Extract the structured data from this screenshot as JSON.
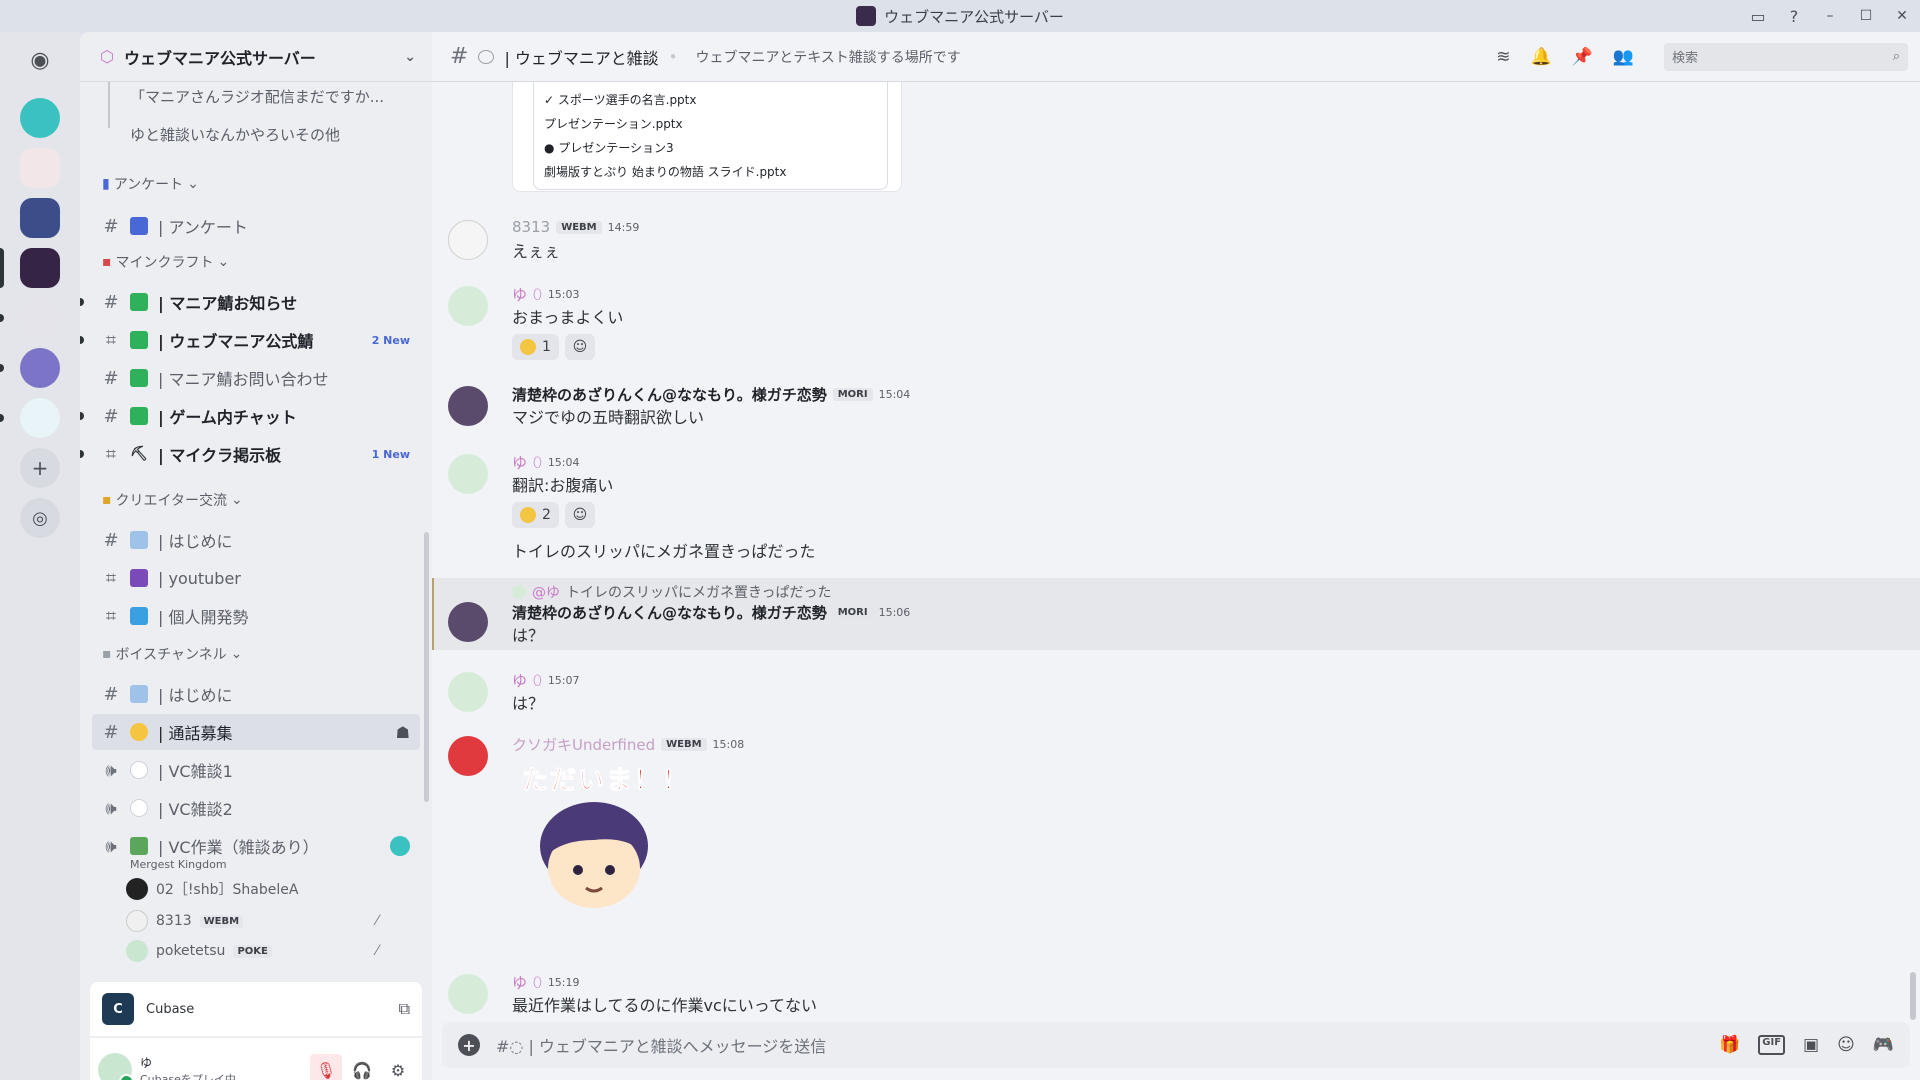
{
  "window": {
    "title": "ウェブマニア公式サーバー",
    "buttons": {
      "minimize": "–",
      "maximize": "☐",
      "close": "✕"
    }
  },
  "rail": {
    "servers": [
      "discord-home",
      "server-1",
      "server-2",
      "server-3",
      "server-4-active",
      "server-5",
      "server-6",
      "server-7",
      "add-server",
      "discover"
    ]
  },
  "sidebar": {
    "server_name": "ウェブマニア公式サーバー",
    "threads": [
      "「マニアさんラジオ配信まだですか...",
      "ゆと雑談いなんかやろいその他"
    ],
    "categories": {
      "survey": "アンケート",
      "minecraft": "マインクラフト",
      "creator": "クリエイター交流",
      "voice": "ボイスチャンネル"
    },
    "channels": {
      "survey": "| アンケート",
      "mania_news": "| マニア鯖お知らせ",
      "official": "| ウェブマニア公式鯖",
      "inquiry": "| マニア鯖お問い合わせ",
      "ingame": "| ゲーム内チャット",
      "board": "| マイクラ掲示板",
      "intro1": "| はじめに",
      "youtuber": "| youtuber",
      "indie": "| 個人開発勢",
      "intro2": "| はじめに",
      "recruit": "| 通話募集",
      "vc1": "| VC雑談1",
      "vc2": "| VC雑談2",
      "vcwork": "| VC作業（雑談あり）"
    },
    "badges": {
      "official_new": "2 New",
      "board_new": "1 New"
    },
    "vc_activity": "Mergest Kingdom",
    "vc_users": [
      {
        "name": "02［!shb］ShabeleA",
        "tag": ""
      },
      {
        "name": "8313",
        "tag": "WEBM"
      },
      {
        "name": "poketetsu",
        "tag": "POKE"
      }
    ],
    "activity": {
      "app": "Cubase"
    },
    "user": {
      "name": "ゆ",
      "status": "Cubaseをプレイ中"
    }
  },
  "chat": {
    "channel_name": "| ウェブマニアと雑談",
    "topic": "ウェブマニアとテキスト雑談する場所です",
    "search_placeholder": "検索",
    "embed_items": [
      "✓ スポーツ選手の名言.pptx",
      "プレゼンテーション.pptx",
      "● プレゼンテーション3",
      "劇場版すとぷり 始まりの物語 スライド.pptx"
    ],
    "messages": [
      {
        "author": "8313",
        "role": "WEBM",
        "time": "14:59",
        "text": "えぇぇ"
      },
      {
        "author": "ゆ",
        "time": "15:03",
        "text": "おまっまよくい",
        "reaction_count": "1"
      },
      {
        "author": "清楚枠のあざりんくん@ななもり。様ガチ恋勢",
        "role": "MORI",
        "time": "15:04",
        "text": "マジでゆの五時翻訳欲しい"
      },
      {
        "author": "ゆ",
        "time": "15:04",
        "text": "翻訳:お腹痛い",
        "reaction_count": "2",
        "text2": "トイレのスリッパにメガネ置きっぱだった"
      },
      {
        "reply_mention": "@ゆ",
        "reply_text": "トイレのスリッパにメガネ置きっぱだった",
        "author": "清楚枠のあざりんくん@ななもり。様ガチ恋勢",
        "role": "MORI",
        "time": "15:06",
        "text": "は？"
      },
      {
        "author": "ゆ",
        "time": "15:07",
        "text": "は？"
      },
      {
        "author": "クソガキUnderfined",
        "role": "WEBM",
        "time": "15:08",
        "sticker_text": "ただいま！！"
      },
      {
        "author": "ゆ",
        "time": "15:19",
        "text": "最近作業はしてるのに作業vcにいってない"
      }
    ],
    "composer_placeholder": "| ウェブマニアと雑談へメッセージを送信",
    "composer_tools": {
      "gif": "GIF"
    }
  }
}
